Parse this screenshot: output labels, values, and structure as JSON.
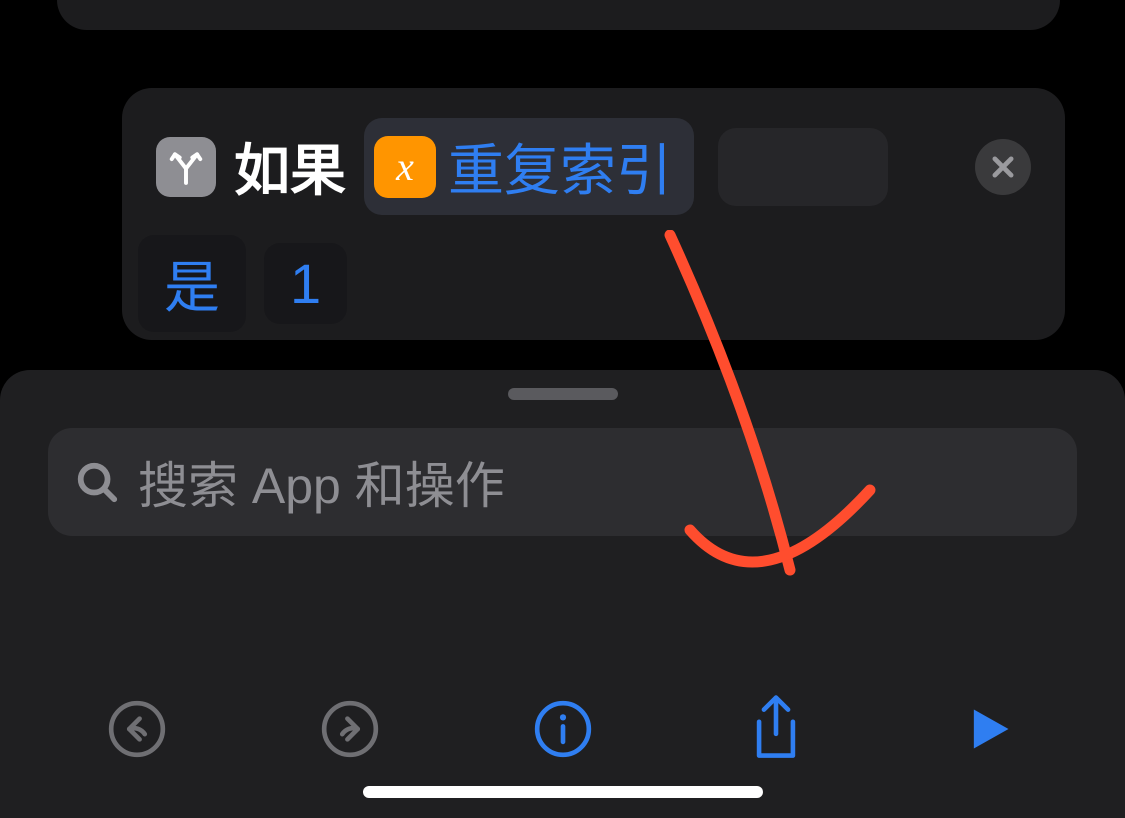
{
  "action": {
    "if_label": "如果",
    "variable_badge_glyph": "x",
    "variable_name": "重复索引",
    "condition_label": "是",
    "value_label": "1"
  },
  "search": {
    "placeholder": "搜索 App 和操作"
  },
  "colors": {
    "accent": "#2f7ef1",
    "variable_badge": "#ff9500",
    "annotation": "#ff4d2e"
  }
}
